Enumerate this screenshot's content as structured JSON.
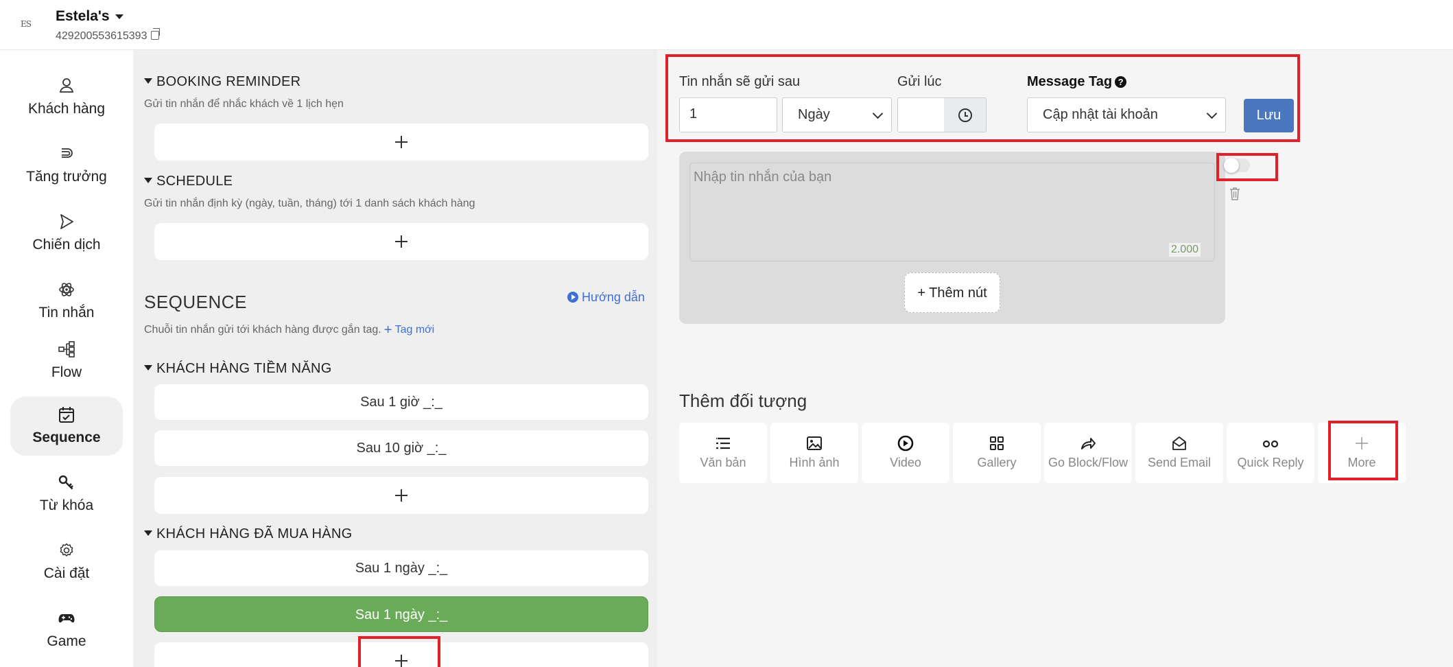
{
  "header": {
    "logo_text": "ES",
    "page_name": "Estela's",
    "page_id": "429200553615393"
  },
  "sidebar": {
    "items": [
      {
        "label": "Khách hàng",
        "icon": "user-icon"
      },
      {
        "label": "Tăng trưởng",
        "icon": "magnet-icon"
      },
      {
        "label": "Chiến dịch",
        "icon": "send-icon"
      },
      {
        "label": "Tin nhắn",
        "icon": "atom-icon"
      },
      {
        "label": "Flow",
        "icon": "flow-icon"
      },
      {
        "label": "Sequence",
        "icon": "calendar-check-icon",
        "active": true
      },
      {
        "label": "Từ khóa",
        "icon": "key-icon"
      },
      {
        "label": "Cài đặt",
        "icon": "gear-icon"
      },
      {
        "label": "Game",
        "icon": "gamepad-icon"
      }
    ]
  },
  "middle": {
    "booking": {
      "title": "BOOKING REMINDER",
      "desc": "Gửi tin nhắn để nhắc khách về 1 lịch hẹn"
    },
    "schedule": {
      "title": "SCHEDULE",
      "desc": "Gửi tin nhắn định kỳ (ngày, tuần, tháng) tới 1 danh sách khách hàng"
    },
    "sequence": {
      "title": "SEQUENCE",
      "guide_label": "Hướng dẫn",
      "desc": "Chuỗi tin nhắn gửi tới khách hàng được gắn tag.",
      "new_tag_label": "Tag mới"
    },
    "groups": [
      {
        "title": "KHÁCH HÀNG TIỀM NĂNG",
        "rows": [
          "Sau 1 giờ _:_",
          "Sau 10 giờ _:_"
        ]
      },
      {
        "title": "KHÁCH HÀNG ĐÃ MUA HÀNG",
        "rows": [
          "Sau 1 ngày _:_",
          "Sau 1 ngày _:_"
        ]
      }
    ]
  },
  "editor": {
    "send_after_label": "Tin nhắn sẽ gửi sau",
    "send_after_value": "1",
    "unit_selected": "Ngày",
    "send_at_label": "Gửi lúc",
    "send_at_value": "",
    "message_tag_label": "Message Tag",
    "message_tag_selected": "Cập nhật tài khoản",
    "save_label": "Lưu",
    "message_placeholder": "Nhập tin nhắn của bạn",
    "char_count": "2.000",
    "add_button_label": "+ Thêm nút",
    "toggle_on": false,
    "add_object_title": "Thêm đối tượng",
    "objects": [
      {
        "label": "Văn bản",
        "icon": "text-list-icon"
      },
      {
        "label": "Hình ảnh",
        "icon": "image-icon"
      },
      {
        "label": "Video",
        "icon": "play-circle-icon"
      },
      {
        "label": "Gallery",
        "icon": "grid-icon"
      },
      {
        "label": "Go Block/Flow",
        "icon": "share-arrow-icon"
      },
      {
        "label": "Send Email",
        "icon": "envelope-open-icon"
      },
      {
        "label": "Quick Reply",
        "icon": "dots-icon"
      },
      {
        "label": "More",
        "icon": "plus-icon"
      }
    ]
  },
  "colors": {
    "accent_blue": "#4b77be",
    "link_blue": "#3f6fd6",
    "selected_green": "#6aab5a",
    "highlight_red": "#e0202a"
  }
}
